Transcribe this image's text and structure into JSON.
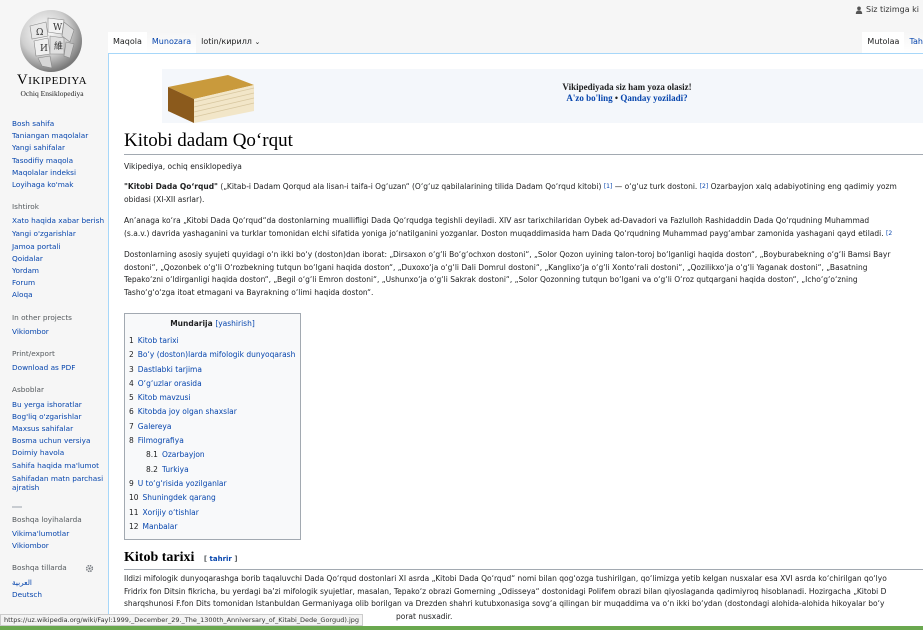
{
  "personal": {
    "user_link": "Siz tizimga ki"
  },
  "logo": {
    "wordmark": "Vikipediya",
    "tagline": "Ochiq Ensiklopediya"
  },
  "tabs": {
    "article": "Maqola",
    "talk": "Munozara",
    "variant": "lotin/кирилл",
    "read": "Mutolaa",
    "edit_partial": "Tah"
  },
  "sidebar": {
    "nav": [
      "Bosh sahifa",
      "Taniangan maqolalar",
      "Yangi sahifalar",
      "Tasodifiy maqola",
      "Maqolalar indeksi",
      "Loyihaga ko'mak"
    ],
    "tools_heading": "Ishtirok",
    "tools": [
      "Xato haqida xabar berish",
      "Yangi o'zgarishlar",
      "Jamoa portali",
      "Qoidalar",
      "Yordam",
      "Forum",
      "Aloqa"
    ],
    "projects_heading": "In other projects",
    "projects": [
      "Vikiombor"
    ],
    "print_heading": "Print/export",
    "print": [
      "Download as PDF"
    ],
    "toolbox_heading": "Asboblar",
    "toolbox": [
      "Bu yerga ishoratlar",
      "Bog'liq o'zgarishlar",
      "Maxsus sahifalar",
      "Bosma uchun versiya",
      "Doimiy havola",
      "Sahifa haqida ma'lumot",
      "Sahifadan matn parchasi ajratish"
    ],
    "other_heading": "Boshqa loyihalarda",
    "other": [
      "Vikima'lumotlar",
      "Vikiombor"
    ],
    "lang_heading": "Boshqa tillarda",
    "langs": [
      "العربية",
      "Deutsch"
    ]
  },
  "notice": {
    "line1": "Vikipediyada siz ham yoza olasiz!",
    "line2_a": "A'zo bo'ling",
    "line2_sep": " • ",
    "line2_b": "Qanday yoziladi?"
  },
  "article": {
    "title": "Kitobi dadam Qo‘rqut",
    "sitesub": "Vikipediya, ochiq ensiklopediya",
    "p1_bold": "\"Kitobi Dada Qo‘rqud\"",
    "p1_line1": " („Kitab-i Dadam Qorqud ala lisan-i taifa-i Og‘uzan“ (O‘g‘uz qabilalarining tilida Dadam Qo‘rqud kitobi) ",
    "p1_ref1": "[1]",
    "p1_line1b": " — o‘g‘uz turk dostoni. ",
    "p1_ref2": "[2]",
    "p1_line1c": " Ozarbayjon xalq adabiyotining eng qadimiy yozm",
    "p1_line2": "obidasi (XI-XII asrlar).",
    "p2_line1": "An’anaga ko‘ra „Kitobi Dada Qo‘rqud“da dostonlarning muallifligi Dada Qo‘rqudga tegishli deyiladi. XIV asr tarixchilaridan Oybek ad-Davadori va Fazlulloh Rashidaddin Dada Qo‘rqudning Muhammad",
    "p2_line2": "(s.a.v.) davrida yashaganini va turklar tomonidan elchi sifatida yoniga jo‘natilganini yozganlar. Doston muqaddimasida ham Dada Qo‘rqudning Muhammad payg‘ambar zamonida yashagani qayd etiladi. ",
    "p2_ref": "[2",
    "p3_line1": "Dostonlarning asosiy syujeti quyidagi o‘n ikki  bo‘y (doston)dan iborat: „Dirsaxon o‘g‘li Bo‘g‘ochxon dostoni“, „Solor Qozon uyining talon-toroj bo‘lganligi haqida doston“, „Boyburabekning o‘g‘li Bamsi Bayr",
    "p3_line2": "dostoni“, „Qozonbek o‘g‘li O‘rozbekning tutqun bo‘lgani haqida doston“, „Duxoxo‘ja o‘g‘li Dali Domrul dostoni“, „Kanglixo‘ja o‘g‘li Xonto‘rali dostoni“, „Qozilikxo‘ja o‘g‘li Yaganak dostoni“, „Basatning",
    "p3_line3": "Tepako‘zni o‘ldirganligi haqida doston“, „Begil o‘g‘li Emron dostoni“, „Ushunxo‘ja o‘g‘li Sakrak dostoni“, „Solor Qozonning tutqun bo‘lgani va o‘g‘li O‘roz qutqargani haqida doston“, „Icho‘g‘o‘zning",
    "p3_line4": "Tasho‘g‘o‘zga itoat etmagani va Bayrakning o‘limi haqida doston“.",
    "toc_title": "Mundarija",
    "toc_toggle": "[yashirish]",
    "toc": [
      {
        "num": "1",
        "label": "Kitob tarixi"
      },
      {
        "num": "2",
        "label": "Bo‘y (doston)larda mifologik dunyoqarash"
      },
      {
        "num": "3",
        "label": "Dastlabki tarjima"
      },
      {
        "num": "4",
        "label": "O‘g‘uzlar orasida"
      },
      {
        "num": "5",
        "label": "Kitob mavzusi"
      },
      {
        "num": "6",
        "label": "Kitobda joy olgan shaxslar"
      },
      {
        "num": "7",
        "label": "Galereya"
      },
      {
        "num": "8",
        "label": "Filmografiya"
      },
      {
        "num": "8.1",
        "label": "Ozarbayjon"
      },
      {
        "num": "8.2",
        "label": "Turkiya"
      },
      {
        "num": "9",
        "label": "U to‘g‘risida yozilganlar"
      },
      {
        "num": "10",
        "label": "Shuningdek qarang"
      },
      {
        "num": "11",
        "label": "Xorijiy o‘tishlar"
      },
      {
        "num": "12",
        "label": "Manbalar"
      }
    ],
    "h2_title": "Kitob tarixi",
    "h2_edit": "tahrir",
    "p4_line1": "Ildizi mifologik dunyoqarashga borib taqaluvchi Dada Qo‘rqud dostonlari XI asrda „Kitobi Dada Qo‘rqud“ nomi bilan qog‘ozga tushirilgan, qo‘limizga yetib kelgan nusxalar esa XVI asrda ko‘chirilgan qo‘lyo",
    "p4_line2": "Fridrix fon Ditsin fikricha, bu yerdagi ba’zi mifologik syujetlar, masalan, Tepako‘z obrazi Gomerning „Odisseya“ dostonidagi Polifem obrazi bilan qiyoslaganda qadimiyroq hisoblanadi. Hozirgacha „Kitobi D",
    "p4_line3": "sharqshunosi F.fon Dits tomonidan Istanbuldan Germaniyaga olib borilgan va Drezden shahri kutubxonasiga sovg‘a qilingan bir muqaddima va o‘n ikki bo‘ydan (dostondagi alohida-alohida hikoyalar bo‘y",
    "p4_line4": "porat nusxadir."
  },
  "statusbar": {
    "url": "https://uz.wikipedia.org/wiki/Fayl:1999,_December_29._The_1300th_Anniversary_of_Kitabi_Dede_Gorgud).jpg"
  },
  "colors": {
    "link": "#0645ad",
    "border": "#a7d7f9",
    "status_rule": "#6aa84f"
  }
}
